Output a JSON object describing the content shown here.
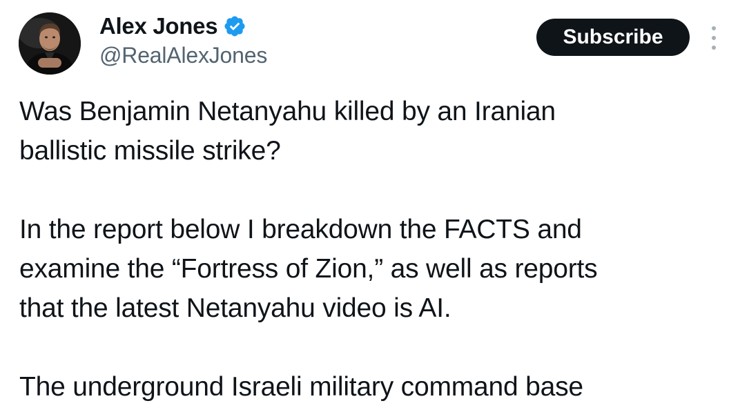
{
  "author": {
    "display_name": "Alex Jones",
    "handle": "@RealAlexJones",
    "verified_icon": "verified-badge-icon",
    "verified_color": "#1d9bf0"
  },
  "actions": {
    "subscribe_label": "Subscribe",
    "more_icon": "more-vertical-icon"
  },
  "post": {
    "paragraphs": [
      {
        "lines": [
          "Was Benjamin Netanyahu killed by an Iranian",
          "ballistic missile strike?"
        ]
      },
      {
        "lines": [
          "In the report below I breakdown the FACTS and",
          "examine the “Fortress of Zion,” as well as reports",
          "that the latest Netanyahu video is AI."
        ]
      },
      {
        "lines": [
          "The underground Israeli military command base"
        ]
      }
    ]
  },
  "colors": {
    "text_primary": "#0f1419",
    "text_secondary": "#536471",
    "button_bg": "#0f1419",
    "button_text": "#ffffff",
    "background": "#ffffff"
  }
}
